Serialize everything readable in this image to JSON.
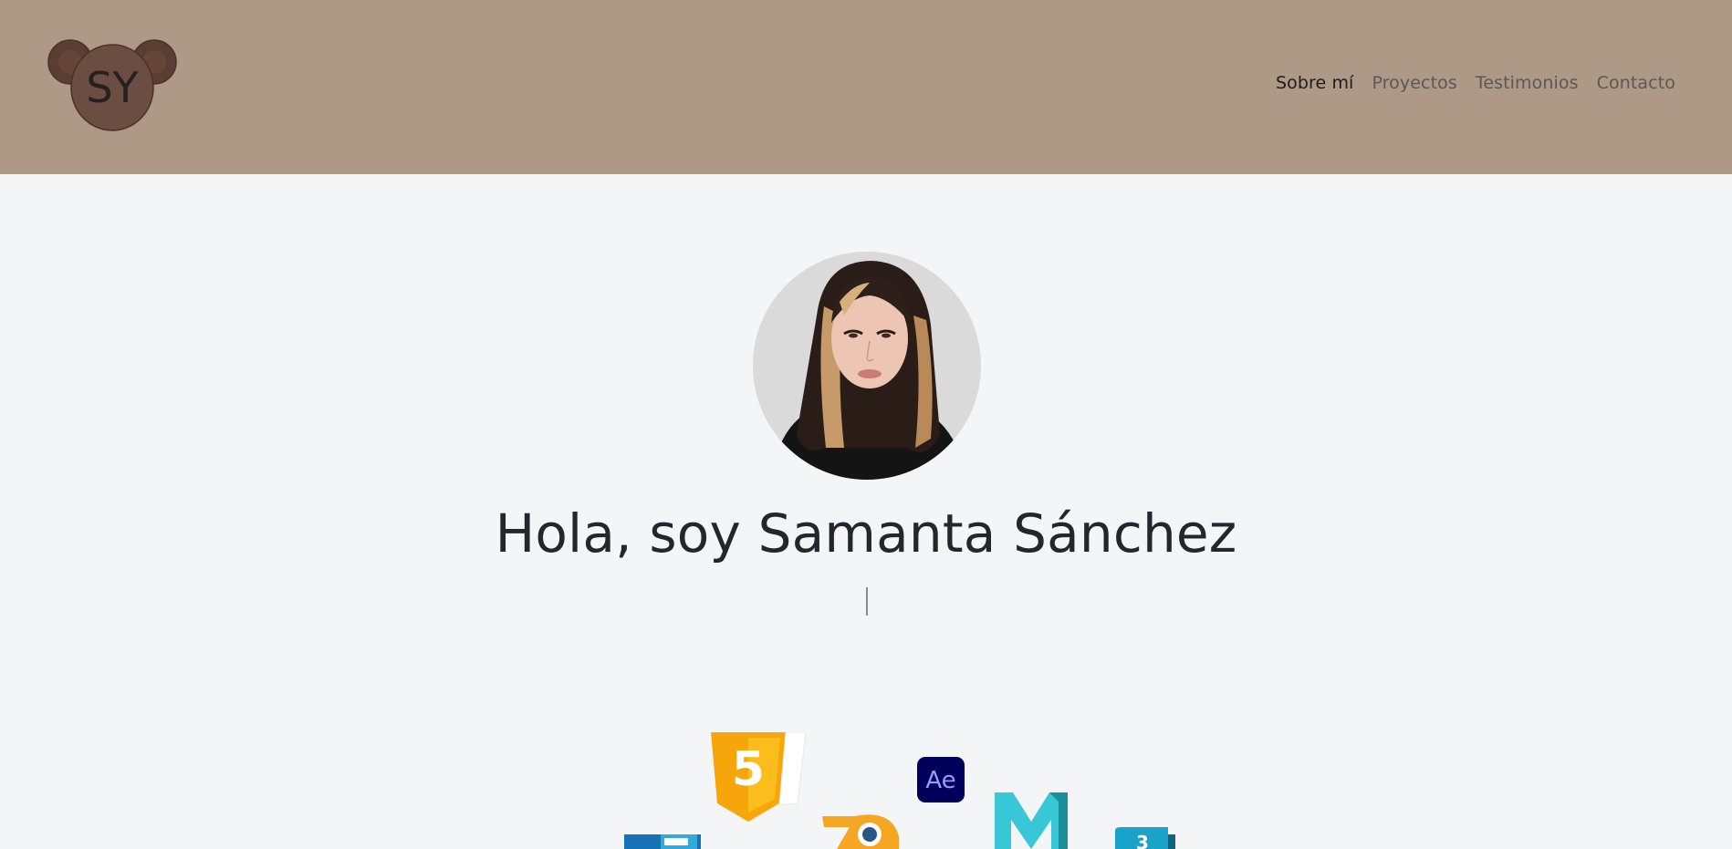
{
  "brand": {
    "logo_text": "SY",
    "colors": {
      "header_bg": "#ae9886",
      "logo_face": "#6b4d41",
      "logo_ear": "#5a3e34",
      "page_bg": "#f4f5f7"
    }
  },
  "nav": {
    "items": [
      {
        "label": "Sobre mí",
        "active": true
      },
      {
        "label": "Proyectos",
        "active": false
      },
      {
        "label": "Testimonios",
        "active": false
      },
      {
        "label": "Contacto",
        "active": false
      }
    ]
  },
  "hero": {
    "avatar": "profile-photo",
    "title": "Hola, soy Samanta Sánchez",
    "typing_text": ""
  },
  "tech_icons": [
    {
      "name": "html5-icon",
      "label": "5"
    },
    {
      "name": "after-effects-icon",
      "label": "Ae"
    },
    {
      "name": "blender-icon",
      "label": ""
    },
    {
      "name": "maya-icon",
      "label": "M"
    },
    {
      "name": "css3-icon",
      "label": ""
    },
    {
      "name": "3ds-max-icon",
      "label": "3"
    }
  ]
}
